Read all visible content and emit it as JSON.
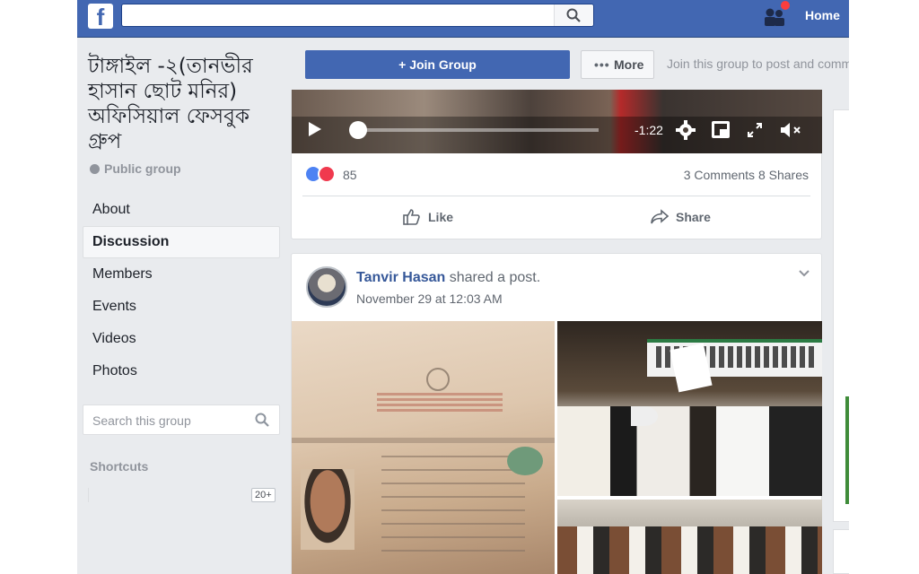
{
  "topbar": {
    "logo": "f",
    "search_value": "",
    "home_label": "Home"
  },
  "group": {
    "title": "টাঙ্গাইল -২(তানভীর হাসান ছোট মনির) অফিসিয়াল ফেসবুক গ্রুপ",
    "privacy": "Public group"
  },
  "nav": {
    "items": [
      {
        "label": "About"
      },
      {
        "label": "Discussion"
      },
      {
        "label": "Members"
      },
      {
        "label": "Events"
      },
      {
        "label": "Videos"
      },
      {
        "label": "Photos"
      }
    ],
    "active": "Discussion"
  },
  "group_search": {
    "placeholder": "Search this group"
  },
  "shortcuts": {
    "label": "Shortcuts",
    "count": "20+"
  },
  "actions": {
    "join_label": "+ Join Group",
    "more_label": "More",
    "hint": "Join this group to post and comm"
  },
  "post1": {
    "video": {
      "time_remaining": "-1:22",
      "progress_percent": 3
    },
    "reaction_count": "85",
    "comments_shares": "3 Comments  8 Shares",
    "like_label": "Like",
    "share_label": "Share"
  },
  "post2": {
    "author": "Tanvir Hasan",
    "action": " shared a post.",
    "timestamp": "November 29 at 12:03 AM"
  },
  "colors": {
    "brand": "#4267b2",
    "link": "#365899",
    "background": "#e9ebee"
  },
  "icons": [
    "facebook-logo-icon",
    "search-icon",
    "friends-icon",
    "globe-icon",
    "play-icon",
    "gear-icon",
    "pip-icon",
    "fullscreen-icon",
    "mute-icon",
    "like-icon",
    "share-icon",
    "chevron-down-icon"
  ]
}
